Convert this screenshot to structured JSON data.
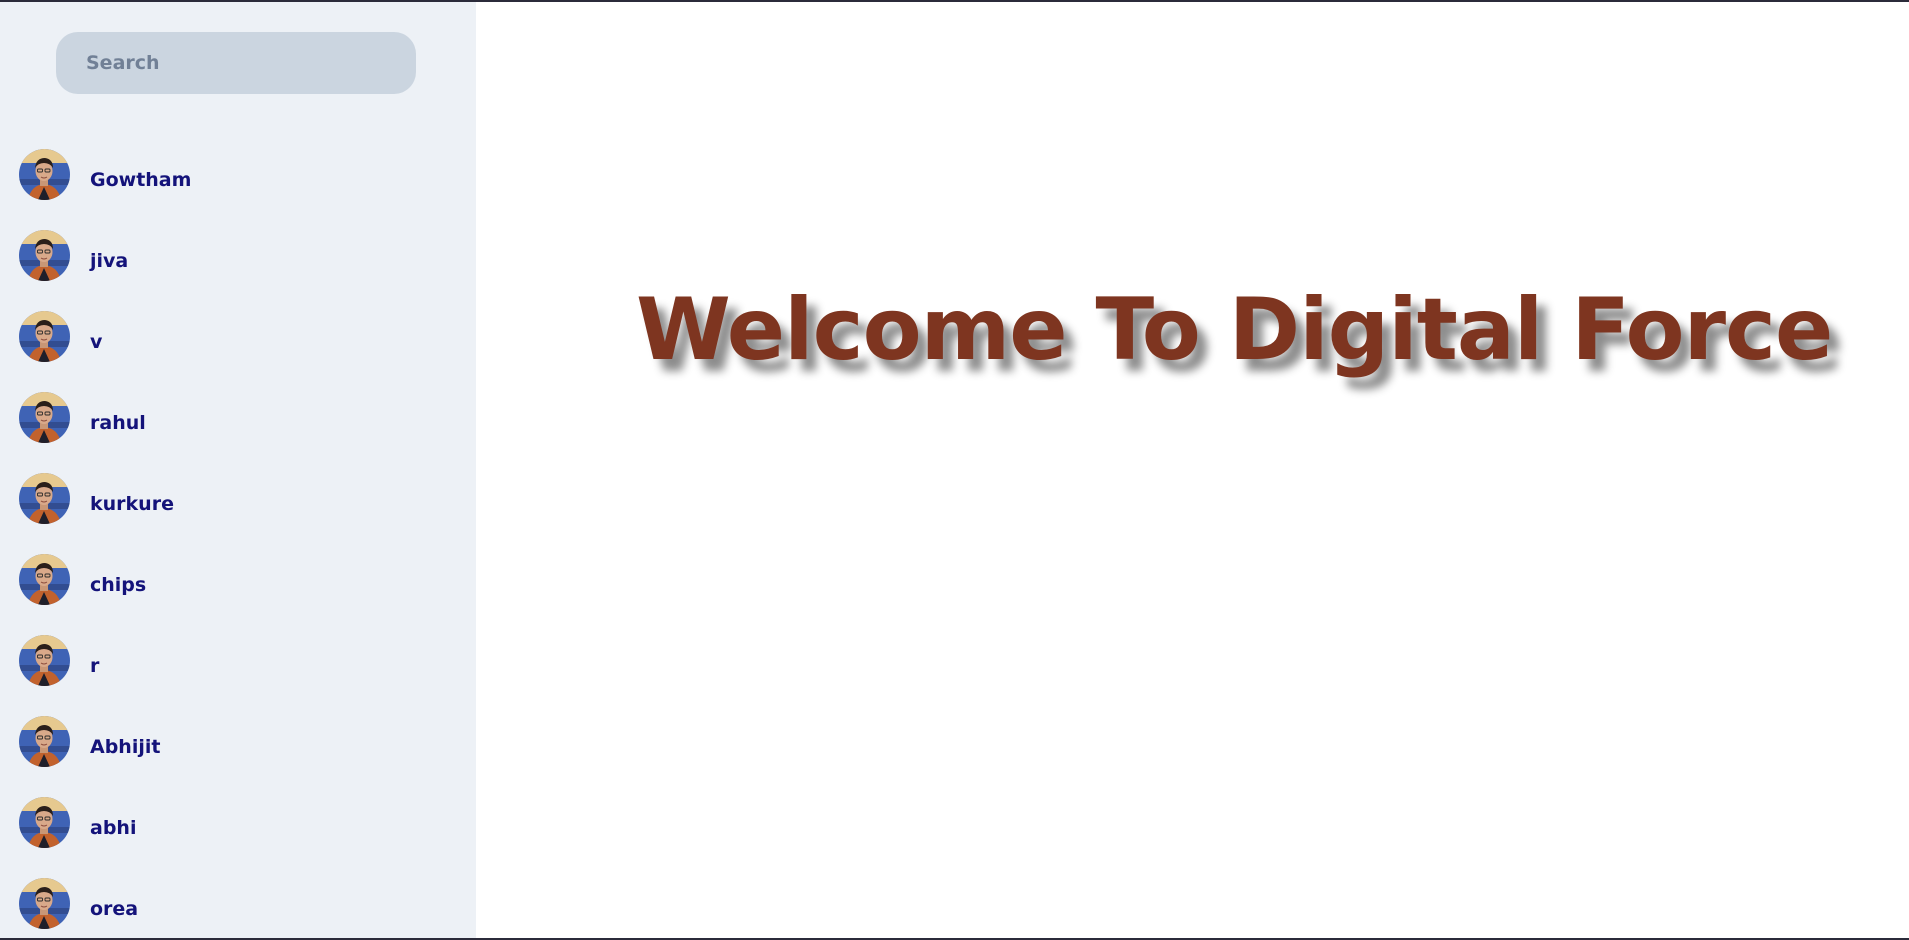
{
  "colors": {
    "sidebar_bg": "#edf1f6",
    "search_bg": "#cbd5e0",
    "contact_name": "#14137a",
    "welcome_text": "#7e3520"
  },
  "search": {
    "placeholder": "Search",
    "value": ""
  },
  "contacts": [
    {
      "name": "Gowtham",
      "avatar": "profile-photo"
    },
    {
      "name": "jiva",
      "avatar": "profile-photo"
    },
    {
      "name": "v",
      "avatar": "profile-photo"
    },
    {
      "name": "rahul",
      "avatar": "profile-photo"
    },
    {
      "name": "kurkure",
      "avatar": "profile-photo"
    },
    {
      "name": "chips",
      "avatar": "profile-photo"
    },
    {
      "name": "r",
      "avatar": "profile-photo"
    },
    {
      "name": "Abhijit",
      "avatar": "profile-photo"
    },
    {
      "name": "abhi",
      "avatar": "profile-photo"
    },
    {
      "name": "orea",
      "avatar": "profile-photo"
    }
  ],
  "main": {
    "welcome_text": "Welcome To Digital Force"
  }
}
